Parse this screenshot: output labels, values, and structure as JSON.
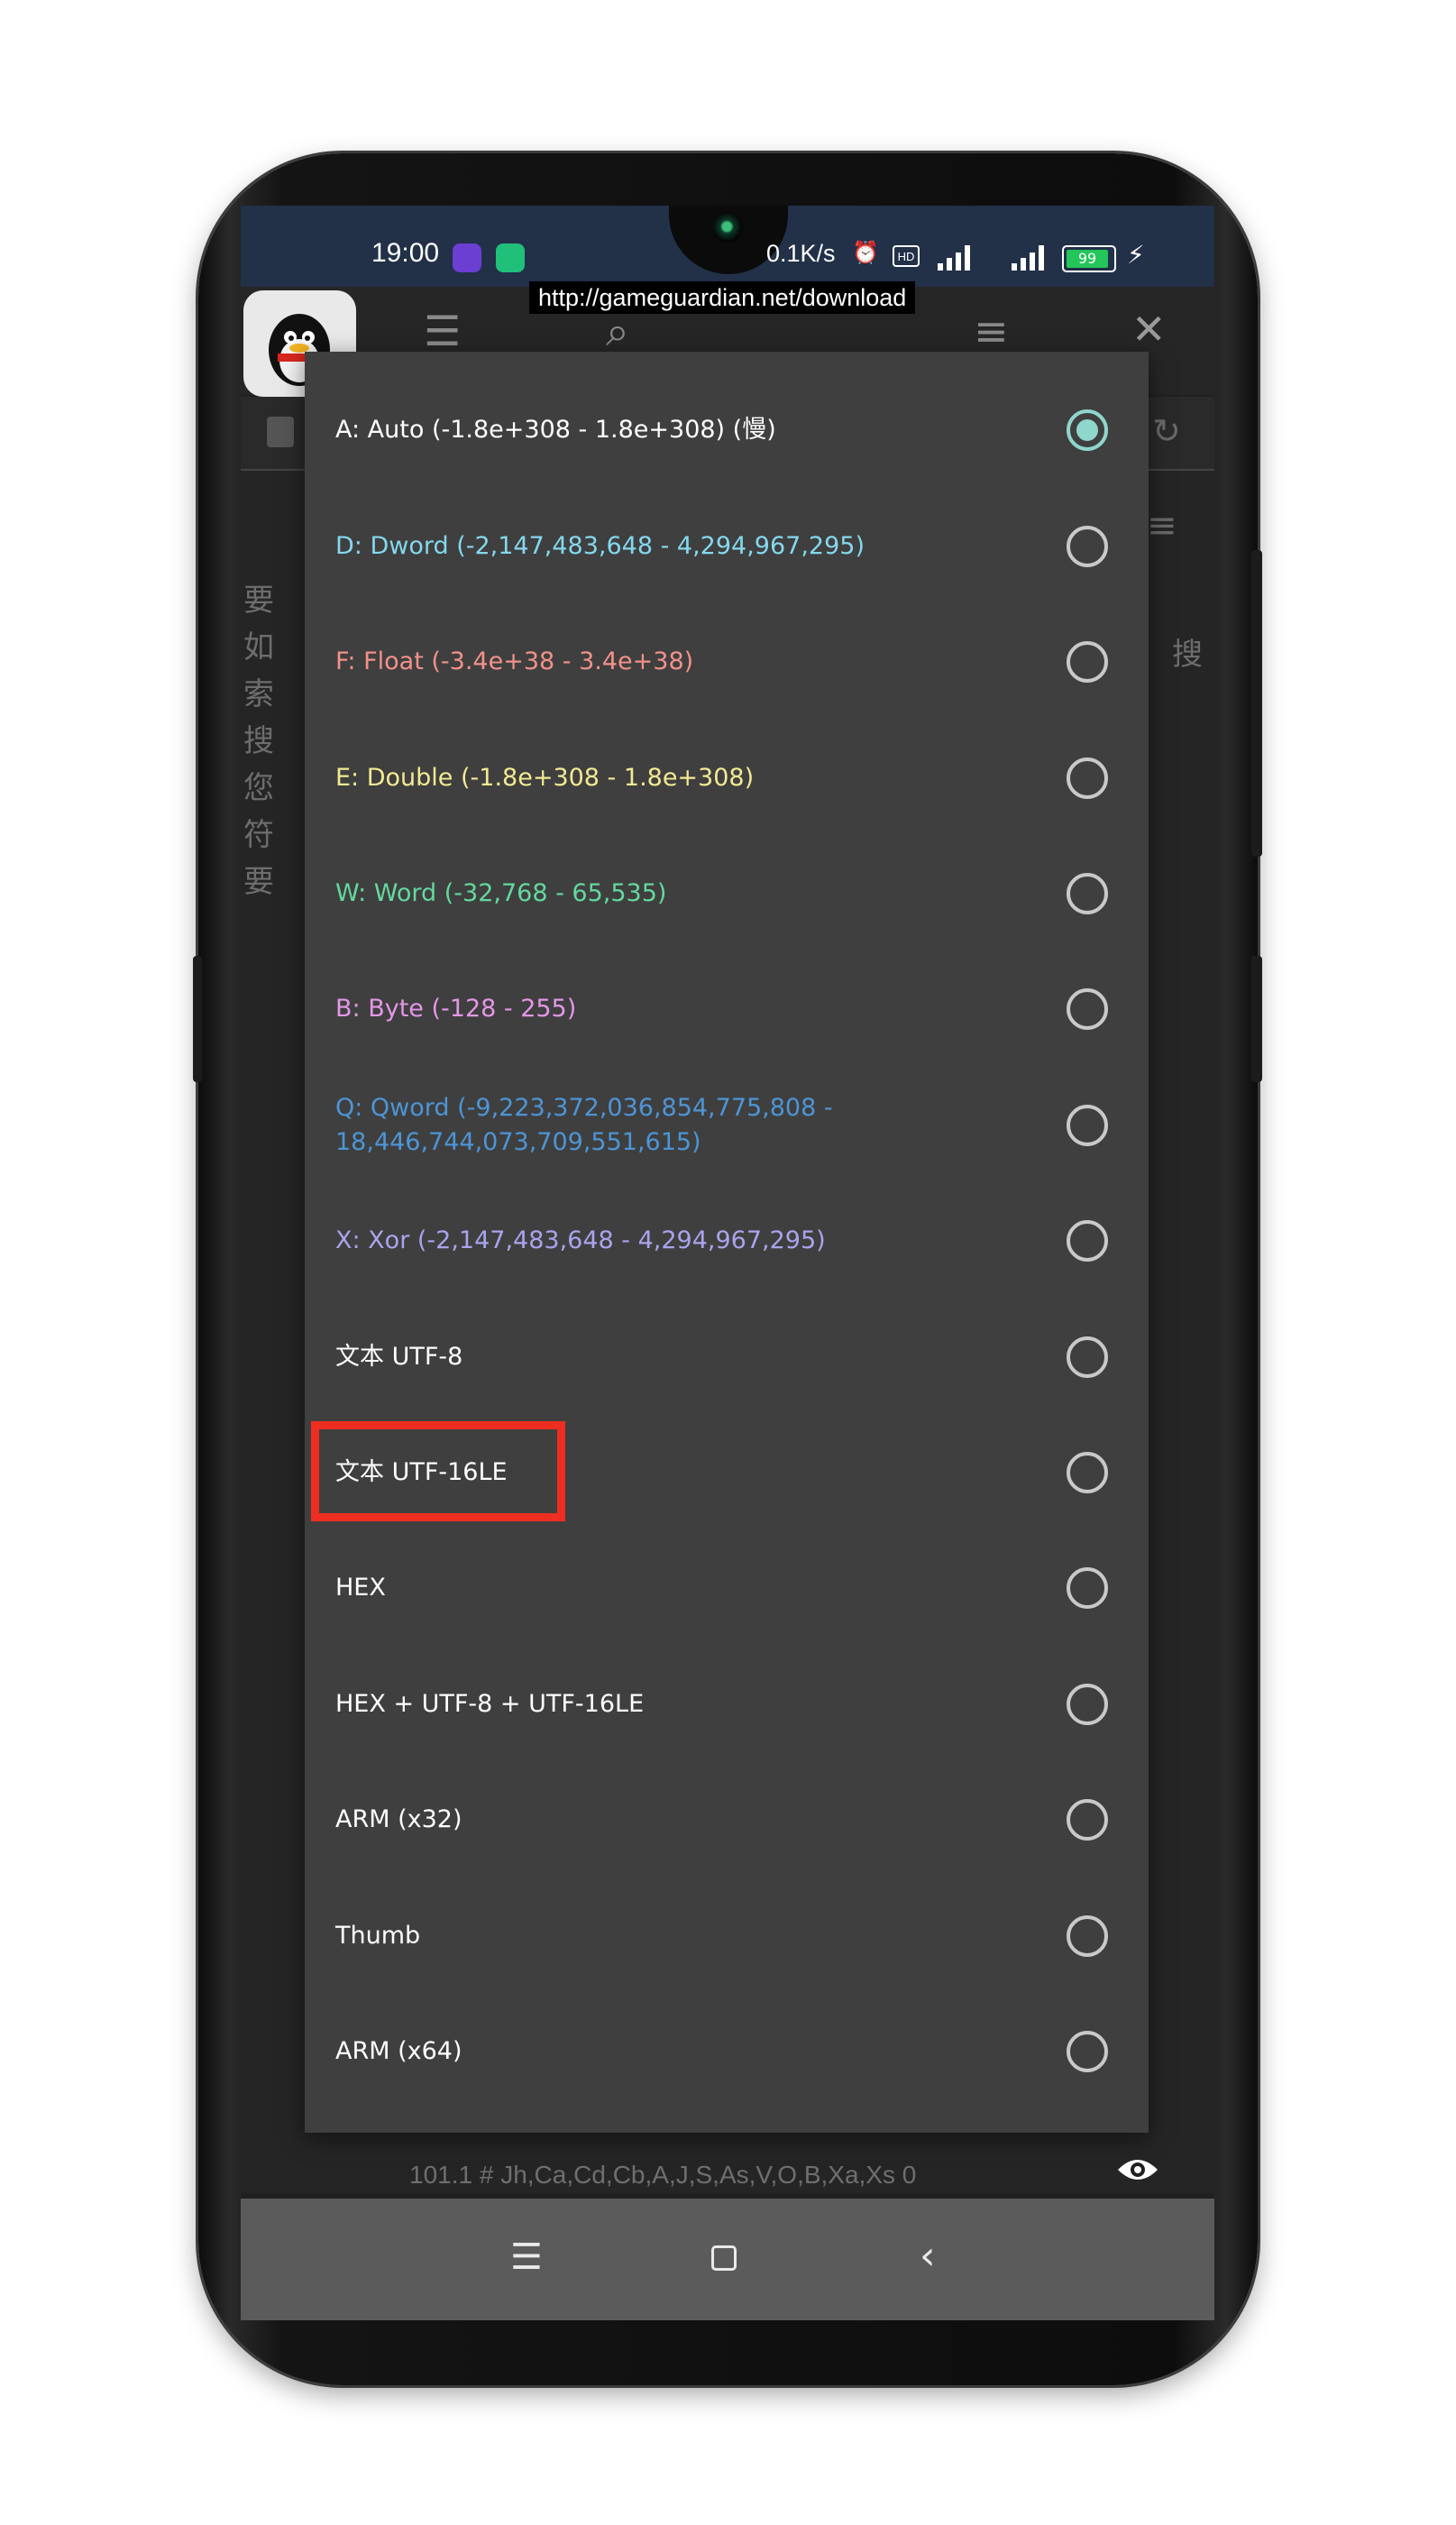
{
  "status_bar": {
    "time": "19:00",
    "network_speed": "0.1K/s",
    "battery": "99",
    "icons": [
      "alarm-icon",
      "hd-icon",
      "signal-4g-icon",
      "signal-4g-icon",
      "battery-icon",
      "charging-icon"
    ]
  },
  "url_banner": "http://gameguardian.net/download",
  "background": {
    "side_text": [
      "要",
      "如",
      "索",
      "搜",
      "您",
      "符",
      "要"
    ],
    "right_text": "搜",
    "footer": "101.1 # Jh,Ca,Cd,Cb,A,J,S,As,V,O,B,Xa,Xs 0"
  },
  "dialog": {
    "selected_index": 0,
    "options": [
      {
        "label": "A: Auto (-1.8e+308 - 1.8e+308) (慢)",
        "color": "#ffffff",
        "checked": true
      },
      {
        "label": "D: Dword (-2,147,483,648 - 4,294,967,295)",
        "color": "#84d8ee",
        "checked": false
      },
      {
        "label": "F: Float (-3.4e+38 - 3.4e+38)",
        "color": "#f2928a",
        "checked": false
      },
      {
        "label": "E: Double (-1.8e+308 - 1.8e+308)",
        "color": "#f2ea93",
        "checked": false
      },
      {
        "label": "W: Word (-32,768 - 65,535)",
        "color": "#64d89e",
        "checked": false
      },
      {
        "label": "B: Byte (-128 - 255)",
        "color": "#e497e8",
        "checked": false
      },
      {
        "label": "Q: Qword (-9,223,372,036,854,775,808 -\n18,446,744,073,709,551,615)",
        "color": "#4d95d6",
        "checked": false
      },
      {
        "label": "X: Xor (-2,147,483,648 - 4,294,967,295)",
        "color": "#a9a4ee",
        "checked": false
      },
      {
        "label": "文本 UTF-8",
        "color": "#ffffff",
        "checked": false
      },
      {
        "label": "文本 UTF-16LE",
        "color": "#ffffff",
        "checked": false
      },
      {
        "label": "HEX",
        "color": "#ffffff",
        "checked": false
      },
      {
        "label": "HEX + UTF-8 + UTF-16LE",
        "color": "#ffffff",
        "checked": false
      },
      {
        "label": "ARM (x32)",
        "color": "#ffffff",
        "checked": false
      },
      {
        "label": "Thumb",
        "color": "#ffffff",
        "checked": false
      },
      {
        "label": "ARM (x64)",
        "color": "#ffffff",
        "checked": false
      }
    ]
  },
  "highlight": {
    "target_option": "文本 UTF-16LE",
    "color": "#ef2e22"
  },
  "colors": {
    "radio_selected": "#8fd6cc",
    "radio_unselected": "#c9c9c9",
    "dialog_bg": "#3f3f3f"
  }
}
